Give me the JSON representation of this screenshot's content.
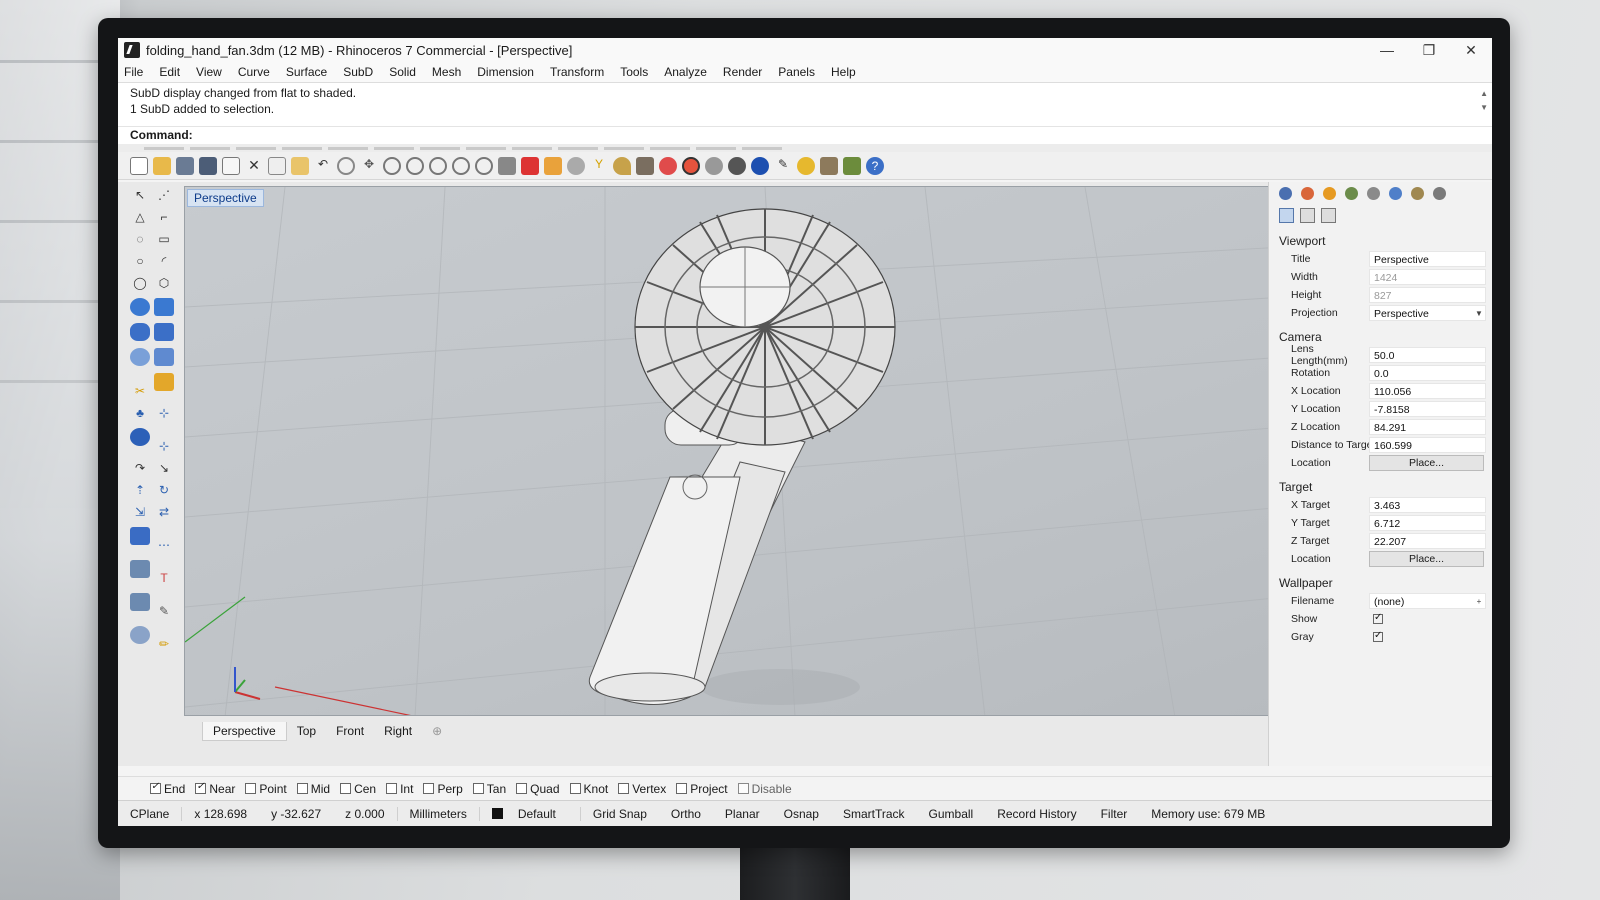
{
  "window": {
    "title": "folding_hand_fan.3dm (12 MB) - Rhinoceros 7 Commercial - [Perspective]",
    "minimize": "—",
    "restore": "❐",
    "close": "✕"
  },
  "menu": [
    "File",
    "Edit",
    "View",
    "Curve",
    "Surface",
    "SubD",
    "Solid",
    "Mesh",
    "Dimension",
    "Transform",
    "Tools",
    "Analyze",
    "Render",
    "Panels",
    "Help"
  ],
  "command_history": [
    "SubD display changed from flat to shaded.",
    "1 SubD added to selection."
  ],
  "command": {
    "label": "Command:",
    "value": ""
  },
  "viewport": {
    "active_label": "Perspective",
    "tabs": [
      "Perspective",
      "Top",
      "Front",
      "Right"
    ]
  },
  "properties": {
    "viewport_section": "Viewport",
    "title_label": "Title",
    "title_value": "Perspective",
    "width_label": "Width",
    "width_value": "1424",
    "height_label": "Height",
    "height_value": "827",
    "projection_label": "Projection",
    "projection_value": "Perspective",
    "camera_section": "Camera",
    "lens_label": "Lens Length(mm)",
    "lens_value": "50.0",
    "rotation_label": "Rotation",
    "rotation_value": "0.0",
    "xloc_label": "X Location",
    "xloc_value": "110.056",
    "yloc_label": "Y Location",
    "yloc_value": "-7.8158",
    "zloc_label": "Z Location",
    "zloc_value": "84.291",
    "dist_label": "Distance to Target",
    "dist_value": "160.599",
    "cam_location_label": "Location",
    "cam_place": "Place...",
    "target_section": "Target",
    "xt_label": "X Target",
    "xt_value": "3.463",
    "yt_label": "Y Target",
    "yt_value": "6.712",
    "zt_label": "Z Target",
    "zt_value": "22.207",
    "tgt_location_label": "Location",
    "tgt_place": "Place...",
    "wallpaper_section": "Wallpaper",
    "filename_label": "Filename",
    "filename_value": "(none)",
    "show_label": "Show",
    "gray_label": "Gray"
  },
  "osnaps": [
    {
      "label": "End",
      "on": true
    },
    {
      "label": "Near",
      "on": true
    },
    {
      "label": "Point",
      "on": false
    },
    {
      "label": "Mid",
      "on": false
    },
    {
      "label": "Cen",
      "on": false
    },
    {
      "label": "Int",
      "on": false
    },
    {
      "label": "Perp",
      "on": false
    },
    {
      "label": "Tan",
      "on": false
    },
    {
      "label": "Quad",
      "on": false
    },
    {
      "label": "Knot",
      "on": false
    },
    {
      "label": "Vertex",
      "on": false
    },
    {
      "label": "Project",
      "on": false
    }
  ],
  "osnap_disable": "Disable",
  "status": {
    "cplane": "CPlane",
    "x": "x 128.698",
    "y": "y -32.627",
    "z": "z 0.000",
    "units": "Millimeters",
    "layer": "Default",
    "grid_snap": "Grid Snap",
    "ortho": "Ortho",
    "planar": "Planar",
    "osnap": "Osnap",
    "smarttrack": "SmartTrack",
    "gumball": "Gumball",
    "record_history": "Record History",
    "filter": "Filter",
    "memory": "Memory use: 679 MB"
  },
  "colors": {
    "accent": "#0d3b8a",
    "viewport_bg": "#c2c6ca",
    "model": "#eeeeee"
  }
}
